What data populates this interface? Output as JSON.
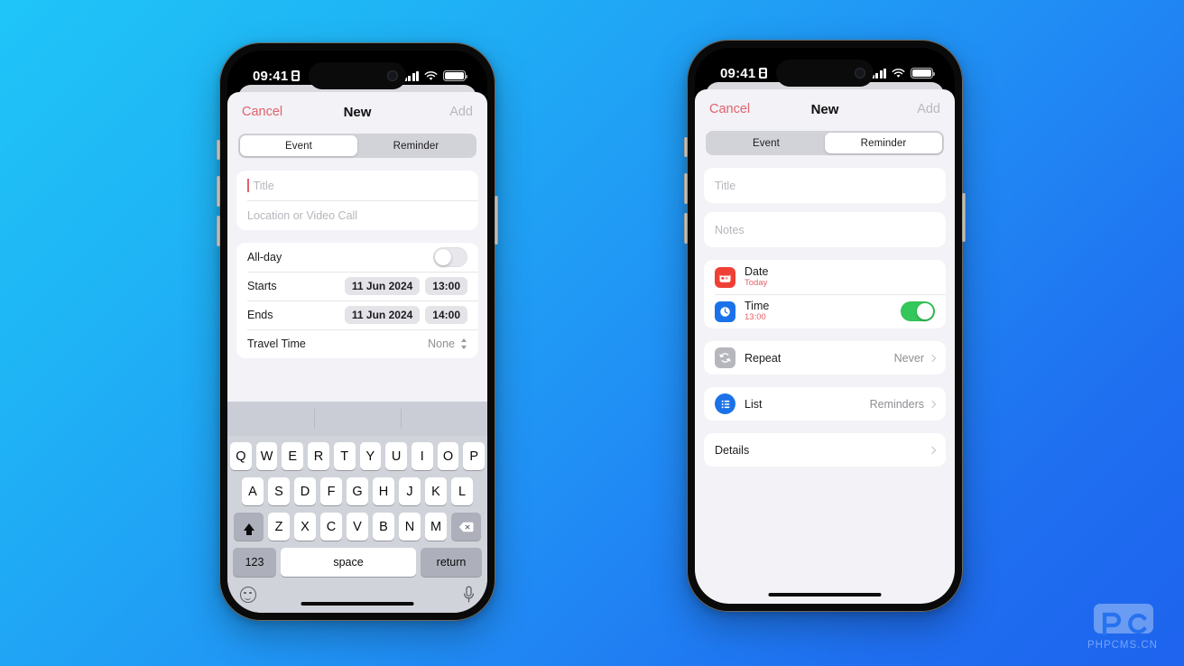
{
  "background": {
    "gradient_from": "#1FC5F8",
    "gradient_to": "#1E63EE"
  },
  "watermark": {
    "text": "PHPCMS.CN",
    "logo": "pc-logo-icon",
    "color": "#bdd6fb"
  },
  "phones": [
    {
      "id": "left",
      "status_bar": {
        "time": "09:41",
        "lock_icon": "lock-icon",
        "signal_icon": "cellular-signal-icon",
        "wifi_icon": "wifi-icon",
        "battery_icon": "battery-icon"
      },
      "nav": {
        "cancel": "Cancel",
        "title": "New",
        "add": "Add"
      },
      "segmented": {
        "options": [
          "Event",
          "Reminder"
        ],
        "selected": "Event"
      },
      "fields": {
        "title_placeholder": "Title",
        "location_placeholder": "Location or Video Call"
      },
      "rows": {
        "allday_label": "All-day",
        "allday_on": false,
        "starts_label": "Starts",
        "starts_date": "11 Jun 2024",
        "starts_time": "13:00",
        "ends_label": "Ends",
        "ends_date": "11 Jun 2024",
        "ends_time": "14:00",
        "travel_label": "Travel Time",
        "travel_value": "None"
      },
      "keyboard": {
        "row1": [
          "Q",
          "W",
          "E",
          "R",
          "T",
          "Y",
          "U",
          "I",
          "O",
          "P"
        ],
        "row2": [
          "A",
          "S",
          "D",
          "F",
          "G",
          "H",
          "J",
          "K",
          "L"
        ],
        "row3": [
          "Z",
          "X",
          "C",
          "V",
          "B",
          "N",
          "M"
        ],
        "shift_icon": "shift-icon",
        "delete_icon": "backspace-icon",
        "numeric_label": "123",
        "space_label": "space",
        "return_label": "return",
        "emoji_icon": "emoji-icon",
        "dictation_icon": "microphone-icon"
      }
    },
    {
      "id": "right",
      "status_bar": {
        "time": "09:41",
        "lock_icon": "lock-icon",
        "signal_icon": "cellular-signal-icon",
        "wifi_icon": "wifi-icon",
        "battery_icon": "battery-icon"
      },
      "nav": {
        "cancel": "Cancel",
        "title": "New",
        "add": "Add"
      },
      "segmented": {
        "options": [
          "Event",
          "Reminder"
        ],
        "selected": "Reminder"
      },
      "fields": {
        "title_placeholder": "Title",
        "notes_placeholder": "Notes"
      },
      "rows": {
        "date_label": "Date",
        "date_value": "Today",
        "date_icon": "calendar-icon",
        "time_label": "Time",
        "time_value": "13:00",
        "time_icon": "clock-icon",
        "time_on": true,
        "repeat_label": "Repeat",
        "repeat_value": "Never",
        "repeat_icon": "repeat-icon",
        "list_label": "List",
        "list_value": "Reminders",
        "list_icon": "list-icon",
        "details_label": "Details"
      }
    }
  ],
  "colors": {
    "accent_red": "#e2626b",
    "toggle_green": "#34c759",
    "icon_red": "#ef4036",
    "icon_blue": "#1b72e8",
    "icon_grey": "#b6b6bd"
  }
}
